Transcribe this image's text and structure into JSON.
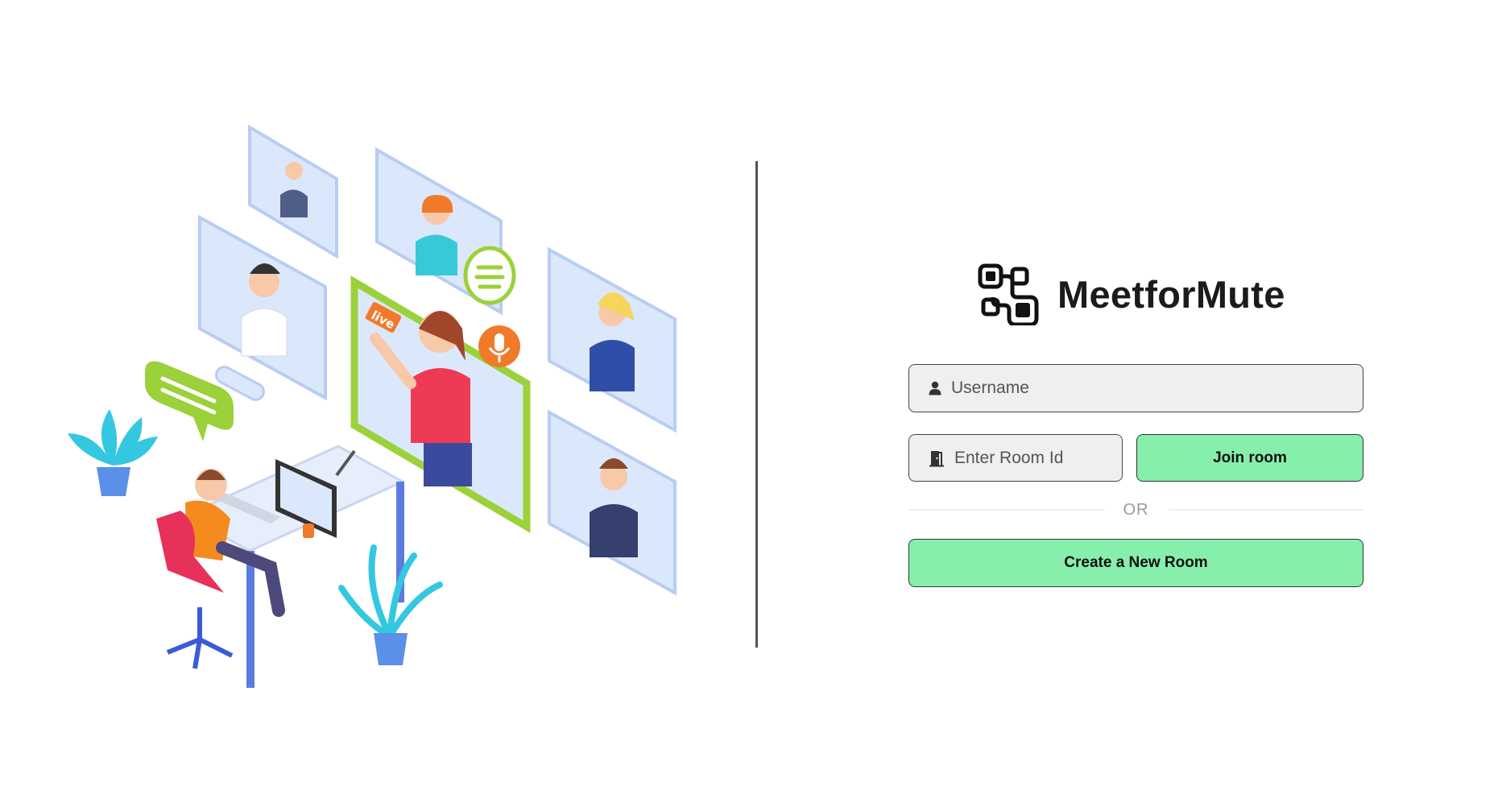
{
  "brand": {
    "name": "MeetforMute",
    "logo_icon": "grid-logo-icon"
  },
  "form": {
    "username": {
      "placeholder": "Username",
      "value": "",
      "icon": "user-icon"
    },
    "room_id": {
      "placeholder": "Enter Room Id",
      "value": "",
      "icon": "door-icon"
    },
    "join_label": "Join room",
    "separator": "OR",
    "create_label": "Create a New Room"
  },
  "illustration": {
    "live_badge": "live",
    "icon": "video-conference-illustration"
  },
  "colors": {
    "button_green": "#86efac",
    "input_bg": "#efefef",
    "divider": "#555555"
  }
}
